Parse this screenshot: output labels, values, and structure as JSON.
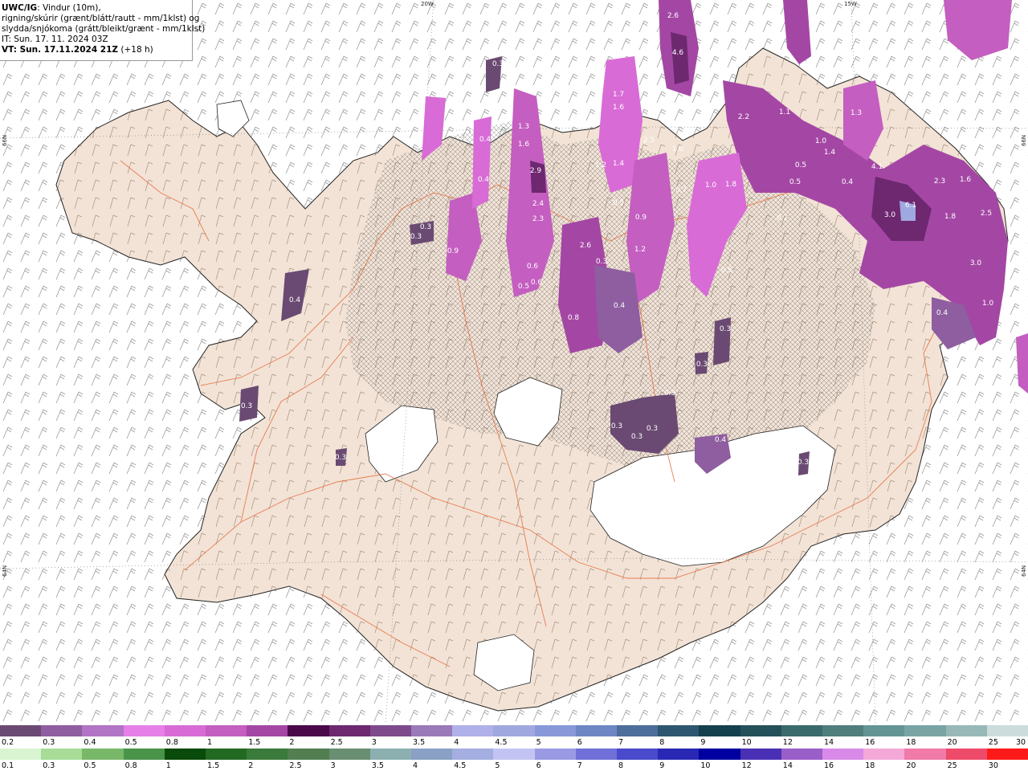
{
  "header": {
    "title_bold": "UWC/IG",
    "title_rest": ": Vindur (10m),",
    "line2": "rigning/skúrir (grænt/blátt/rautt - mm/1klst) og",
    "line3": "slydda/snjókoma (grátt/bleikt/grænt - mm/1klst)",
    "line4": "IT: Sun. 17. 11. 2024 03Z",
    "vt_bold": "VT: Sun. 17.11.2024 21Z",
    "vt_rest": " (+18 h)"
  },
  "coordinates": {
    "top_20w": "20W",
    "top_15w": "15W",
    "left_66n": "66N",
    "left_64n": "64N",
    "right_66n": "66N",
    "right_64n": "64N"
  },
  "map_values": [
    {
      "text": "2.6"
    },
    {
      "text": "4.6"
    },
    {
      "text": "0.3"
    },
    {
      "text": "1.7"
    },
    {
      "text": "1.6"
    },
    {
      "text": "2.2"
    },
    {
      "text": "1.1"
    },
    {
      "text": "1.3"
    },
    {
      "text": "1.3"
    },
    {
      "text": "1.6"
    },
    {
      "text": "2.5"
    },
    {
      "text": "1.0"
    },
    {
      "text": "1.4"
    },
    {
      "text": "1.2"
    },
    {
      "text": "1.4"
    },
    {
      "text": "0.5"
    },
    {
      "text": "4.1"
    },
    {
      "text": "2.3"
    },
    {
      "text": "1.6"
    },
    {
      "text": "2.9"
    },
    {
      "text": "0.5"
    },
    {
      "text": "1.0"
    },
    {
      "text": "1.8"
    },
    {
      "text": "0.4"
    },
    {
      "text": "1.0"
    },
    {
      "text": "0.7"
    },
    {
      "text": "6.1"
    },
    {
      "text": "3.0"
    },
    {
      "text": "1.8"
    },
    {
      "text": "2.5"
    },
    {
      "text": "2.4"
    },
    {
      "text": "2.3"
    },
    {
      "text": "0.5"
    },
    {
      "text": "0.9"
    },
    {
      "text": "0.2"
    },
    {
      "text": "0.3"
    },
    {
      "text": "0.3"
    },
    {
      "text": "0.6"
    },
    {
      "text": "1.2"
    },
    {
      "text": "0.3"
    },
    {
      "text": "0.9"
    },
    {
      "text": "2.6"
    },
    {
      "text": "0.6"
    },
    {
      "text": "0.5"
    },
    {
      "text": "0.4"
    },
    {
      "text": "0.4"
    },
    {
      "text": "0.4"
    },
    {
      "text": "0.4"
    },
    {
      "text": "0.9"
    },
    {
      "text": "3.0"
    },
    {
      "text": "0.8"
    },
    {
      "text": "0.4"
    },
    {
      "text": "1.0"
    },
    {
      "text": "0.3"
    },
    {
      "text": "0.3"
    },
    {
      "text": "0.3"
    },
    {
      "text": "0.3"
    },
    {
      "text": "0.3"
    },
    {
      "text": "0.3"
    },
    {
      "text": "0.3"
    },
    {
      "text": "0.4"
    },
    {
      "text": "0.3"
    },
    {
      "text": "0.3"
    }
  ],
  "legend_snow": {
    "labels": [
      "0.2",
      "0.3",
      "0.4",
      "0.5",
      "0.8",
      "1",
      "1.5",
      "2",
      "2.5",
      "3",
      "3.5",
      "4",
      "4.5",
      "5",
      "6",
      "7",
      "8",
      "9",
      "10",
      "12",
      "14",
      "16",
      "18",
      "20",
      "25",
      "30"
    ],
    "colors": [
      "#6a4a72",
      "#8e5ea0",
      "#b274c4",
      "#e67fe8",
      "#d86bd6",
      "#c45ec0",
      "#a447a4",
      "#4a0a4a",
      "#6d2870",
      "#7e4a8c",
      "#9a7ab8",
      "#b0b0ea",
      "#a0a8e0",
      "#8898d8",
      "#6f86c4",
      "#4d6e9a",
      "#2e5670",
      "#14404e",
      "#24505a",
      "#3a6a6c",
      "#4f7e7c",
      "#649494",
      "#7aa4a4",
      "#98b8b8",
      "#ccdcdc"
    ]
  },
  "legend_rain": {
    "labels": [
      "0.1",
      "0.3",
      "0.5",
      "0.8",
      "1",
      "1.5",
      "2",
      "2.5",
      "3",
      "3.5",
      "4",
      "4.5",
      "5",
      "6",
      "7",
      "8",
      "9",
      "10",
      "12",
      "14",
      "16",
      "18",
      "20",
      "25",
      "30"
    ],
    "colors": [
      "#d8f4d0",
      "#a8dc98",
      "#78b868",
      "#4a944a",
      "#0a4a0a",
      "#226a22",
      "#3a7a3a",
      "#527e52",
      "#6a8e72",
      "#8cb0b0",
      "#8aa0c4",
      "#a4aee0",
      "#c4c4f4",
      "#9a9ae4",
      "#7070d8",
      "#4a4acc",
      "#2828b4",
      "#0000a0",
      "#4a30b4",
      "#9a5ec8",
      "#d88ae8",
      "#f4a8d8",
      "#f07aa8",
      "#ee4a6a",
      "#ff1a1a"
    ]
  }
}
